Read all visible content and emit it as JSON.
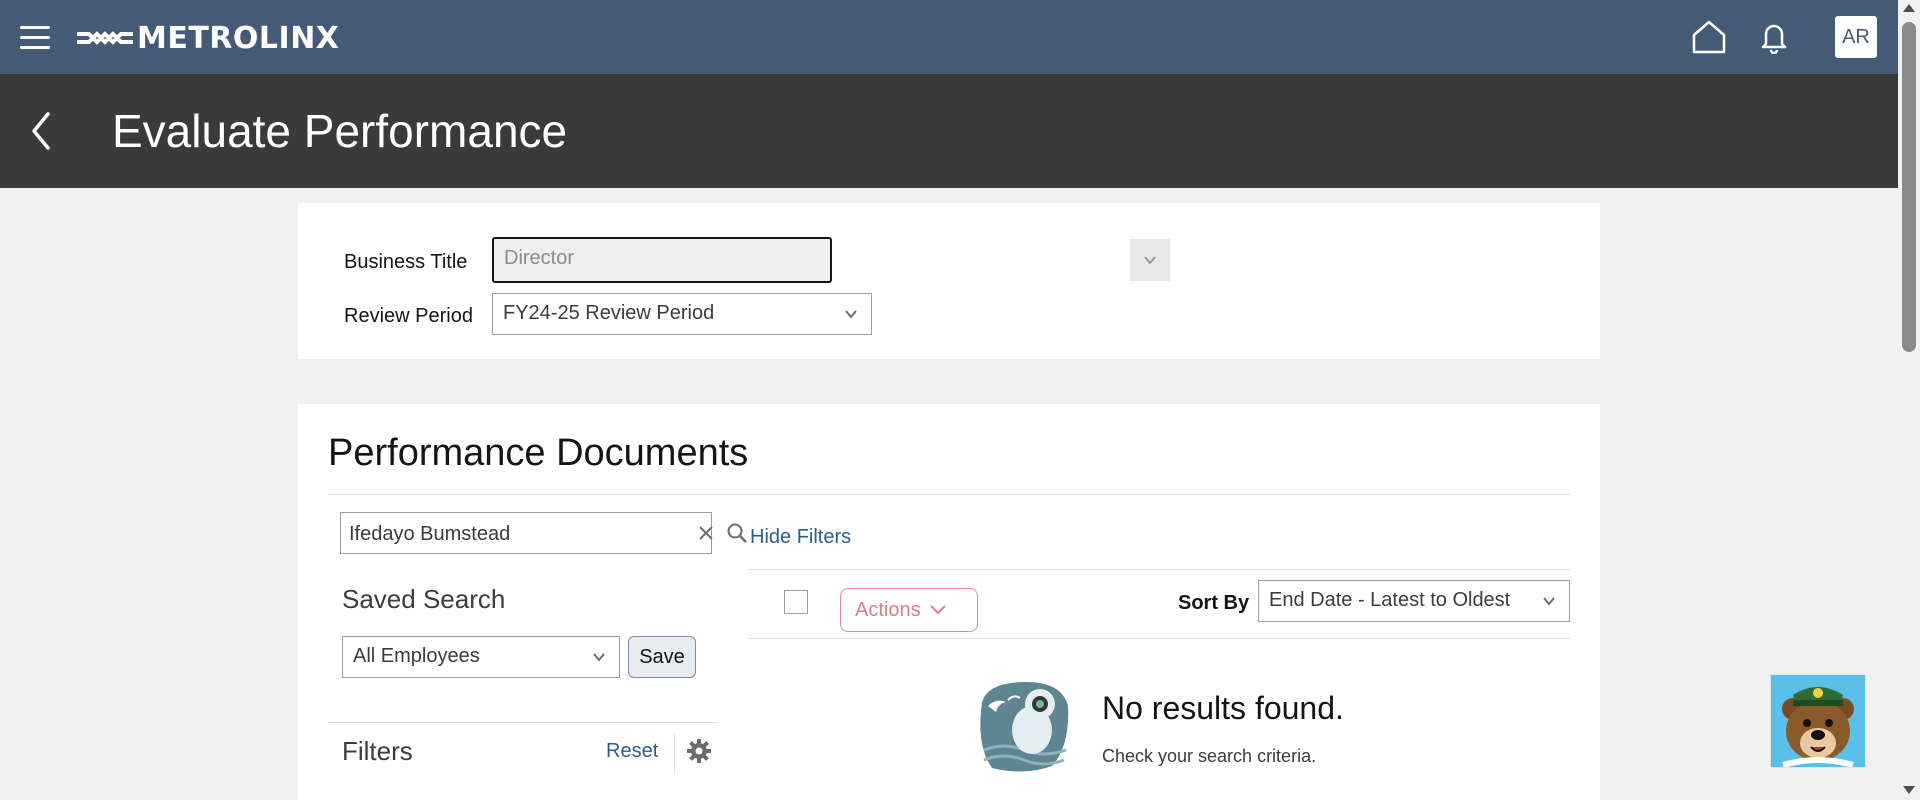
{
  "app": {
    "logo_text": "METROLINX",
    "user_initials": "AR"
  },
  "header": {
    "title": "Evaluate Performance"
  },
  "form": {
    "business_title_label": "Business Title",
    "business_title_value": "Director",
    "review_period_label": "Review Period",
    "review_period_value": "FY24-25 Review Period"
  },
  "documents": {
    "title": "Performance Documents",
    "search_value": "Ifedayo Bumstead",
    "hide_filters": "Hide Filters",
    "saved_search_label": "Saved Search",
    "saved_search_value": "All Employees",
    "save_label": "Save",
    "filters_label": "Filters",
    "reset_label": "Reset",
    "actions_label": "Actions",
    "sort_by_label": "Sort By",
    "sort_value": "End Date - Latest to Oldest",
    "no_results_title": "No results found.",
    "no_results_hint": "Check your search criteria."
  },
  "colors": {
    "topbar": "#455a76",
    "pagehead": "#3a3a3a",
    "link": "#2f5d8a",
    "actions": "#d97c88"
  }
}
